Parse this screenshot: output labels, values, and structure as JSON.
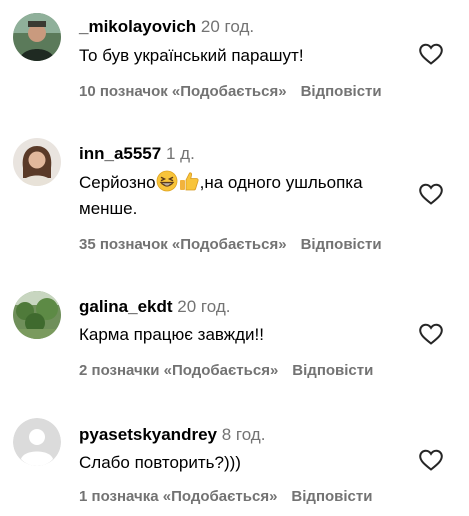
{
  "comments": [
    {
      "username": "_mikolayovich",
      "time": "20 год.",
      "text": "То був український парашут!",
      "likes": "10 позначок «Подобається»",
      "reply": "Відповісти"
    },
    {
      "username": "inn_a5557",
      "time": "1 д.",
      "text_before": "Серйозно",
      "text_after": ",на одного ушльопка менше.",
      "emojis": [
        "grinning-squinting-face-emoji",
        "thumbs-up-emoji"
      ],
      "likes": "35 позначок «Подобається»",
      "reply": "Відповісти"
    },
    {
      "username": "galina_ekdt",
      "time": "20 год.",
      "text": "Карма працює завжди!!",
      "likes": "2 позначки «Подобається»",
      "reply": "Відповісти"
    },
    {
      "username": "pyasetskyandrey",
      "time": "8 год.",
      "text": "Слабо повторить?)))",
      "likes": "1 позначка «Подобається»",
      "reply": "Відповісти"
    }
  ],
  "icons": {
    "like": "heart-outline-icon",
    "default_avatar": "default-avatar-icon"
  },
  "colors": {
    "text": "#000000",
    "secondary": "#737373",
    "background": "#ffffff"
  }
}
